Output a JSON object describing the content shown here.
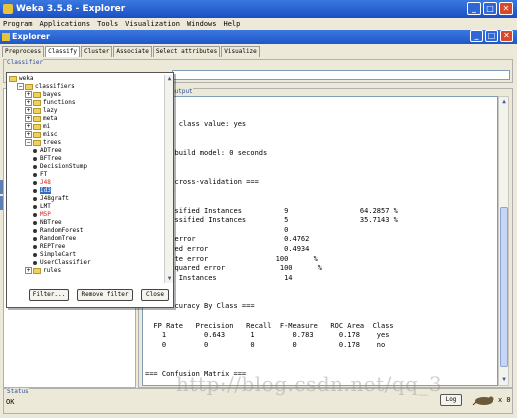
{
  "outer_window": {
    "title": "Weka 3.5.8 - Explorer",
    "menu": [
      "Program",
      "Applications",
      "Tools",
      "Visualization",
      "Windows",
      "Help"
    ]
  },
  "explorer_window": {
    "title": "Explorer",
    "tabs": [
      "Preprocess",
      "Classify",
      "Cluster",
      "Associate",
      "Select attributes",
      "Visualize"
    ],
    "active_tab": "Classify",
    "classifier_group_label": "Classifier",
    "output_label": "output"
  },
  "tree": {
    "rows": [
      {
        "label": "weka",
        "type": "root"
      },
      {
        "label": "classifiers",
        "type": "folder-open"
      },
      {
        "label": "bayes",
        "type": "folder-closed"
      },
      {
        "label": "functions",
        "type": "folder-closed"
      },
      {
        "label": "lazy",
        "type": "folder-closed"
      },
      {
        "label": "meta",
        "type": "folder-closed"
      },
      {
        "label": "mi",
        "type": "folder-closed"
      },
      {
        "label": "misc",
        "type": "folder-closed"
      },
      {
        "label": "trees",
        "type": "folder-open"
      },
      {
        "label": "ADTree",
        "type": "leaf"
      },
      {
        "label": "BFTree",
        "type": "leaf"
      },
      {
        "label": "DecisionStump",
        "type": "leaf"
      },
      {
        "label": "FT",
        "type": "leaf"
      },
      {
        "label": "J48",
        "type": "leaf",
        "style": "red"
      },
      {
        "label": "Id3",
        "type": "leaf",
        "style": "selected"
      },
      {
        "label": "J48graft",
        "type": "leaf"
      },
      {
        "label": "LMT",
        "type": "leaf"
      },
      {
        "label": "M5P",
        "type": "leaf",
        "style": "red"
      },
      {
        "label": "NBTree",
        "type": "leaf"
      },
      {
        "label": "RandomForest",
        "type": "leaf"
      },
      {
        "label": "RandomTree",
        "type": "leaf"
      },
      {
        "label": "REPTree",
        "type": "leaf"
      },
      {
        "label": "SimpleCart",
        "type": "leaf"
      },
      {
        "label": "UserClassifier",
        "type": "leaf"
      },
      {
        "label": "rules",
        "type": "folder-closed"
      }
    ],
    "buttons": {
      "filter": "Filter...",
      "remove_filter": "Remove filter",
      "close": "Close"
    }
  },
  "output_lines": [
    "",
    "",
    "redicts class value: yes",
    "",
    "",
    "ken to build model: 0 seconds",
    "",
    "",
    "sified cross-validation ===",
    "ary ===",
    "",
    "ly Classified Instances          9                 64.2857 %",
    "tly Classified Instances         5                 35.7143 %",
    "atistic                          0",
    "solute error                     0.4762",
    "n squared error                  0.4934",
    " absolute error                100      %",
    "ative squared error             100      %",
    "mber of Instances                14",
    "",
    "",
    "iled Accuracy By Class ===",
    "",
    "  FP Rate   Precision   Recall  F-Measure   ROC Area  Class",
    "    1         0.643      1         0.783      0.178    yes",
    "    0         0          0         0          0.178    no",
    "",
    "",
    "=== Confusion Matrix ===",
    "",
    " a b   <-- classified as",
    " 9 0 | a = yes",
    " 5 0 | b = no"
  ],
  "status": {
    "label": "Status",
    "text": "OK",
    "log_button": "Log",
    "x_count": "x 0"
  },
  "watermark": "http://blog.csdn.net/qq_3",
  "colors": {
    "title_bar": "#1a4fc4",
    "selection": "#316ac5",
    "highlight_red": "#d41a1a"
  }
}
